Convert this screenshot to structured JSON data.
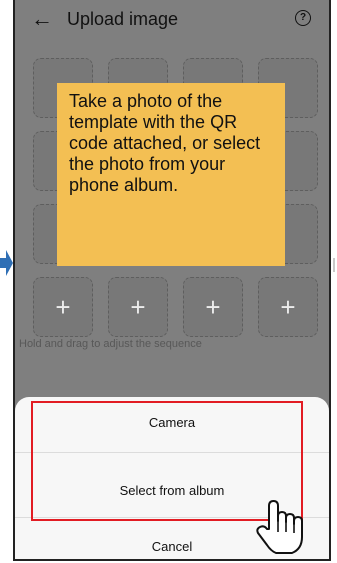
{
  "header": {
    "back_icon": "arrow-left-icon",
    "title": "Upload image",
    "help_icon": "question-circle-icon",
    "help_glyph": "?"
  },
  "grid": {
    "plus_glyph": "+",
    "rows": 4,
    "columns": 4
  },
  "hint": "Hold and drag to adjust the sequence",
  "callout": {
    "text": "Take a photo of the template with the QR code attached, or select the photo from your phone album.",
    "color": "#f3bf53"
  },
  "sheet": {
    "options": [
      "Camera",
      "Select from album"
    ],
    "cancel": "Cancel"
  },
  "colors": {
    "overlay": "#7f7f7f",
    "highlight": "#e21c23",
    "arrow": "#2f6fb5"
  }
}
